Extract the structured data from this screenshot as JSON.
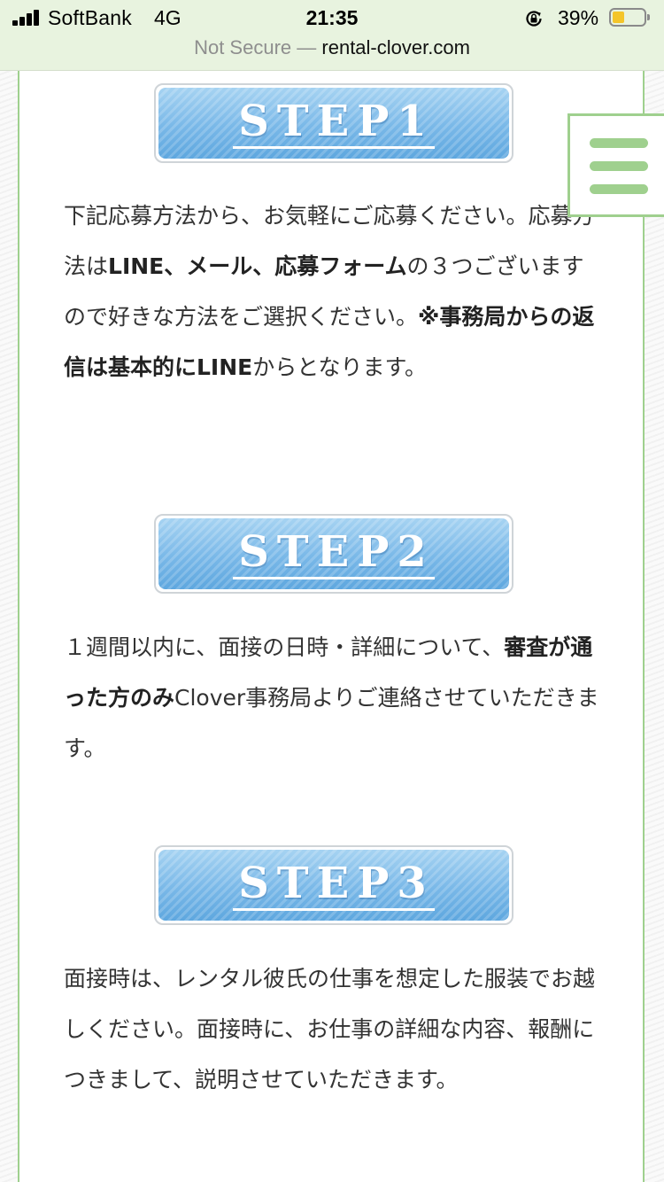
{
  "status_bar": {
    "carrier": "SoftBank",
    "network": "4G",
    "time": "21:35",
    "battery_percent": "39%",
    "battery_level": 0.39,
    "icons": [
      "signal-bars-icon",
      "orientation-lock-icon",
      "battery-icon"
    ]
  },
  "url_bar": {
    "security": "Not Secure",
    "separator": "—",
    "domain": "rental-clover.com"
  },
  "menu": {
    "icon": "hamburger-menu-icon",
    "color": "#9fd08e"
  },
  "colors": {
    "accent_green": "#9fd08e",
    "banner_blue": "#79b8e8",
    "text": "#333333"
  },
  "steps": [
    {
      "label": "STEP1",
      "text_parts": [
        "下記応募方法から、お気軽にご応募ください。応募方法は",
        "LINE、メール、応募フォーム",
        "の３つございますので好きな方法をご選択ください。",
        "※事務局からの返信は基本的にLINE",
        "からとなります。"
      ]
    },
    {
      "label": "STEP2",
      "text_parts": [
        "１週間以内に、面接の日時・詳細について、",
        "審査が通った方のみ",
        "Clover事務局よりご連絡させていただきます。"
      ]
    },
    {
      "label": "STEP3",
      "text_parts": [
        "面接時は、レンタル彼氏の仕事を想定した服装でお越しください。面接時に、お仕事の詳細な内容、報酬につきまして、説明させていただきます。"
      ]
    }
  ]
}
